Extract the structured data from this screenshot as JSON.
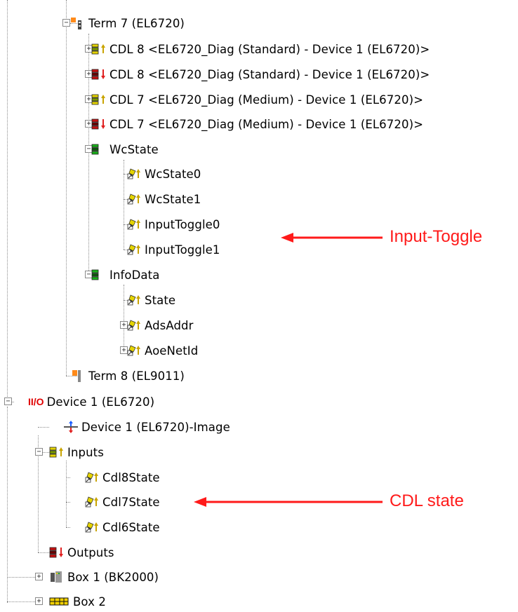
{
  "nodes": [
    {
      "label": "Term 7 (EL6720)",
      "icon": "terminal-icon",
      "expander": "minus"
    },
    {
      "label": "CDL 8 <EL6720_Diag (Standard) - Device 1 (EL6720)>",
      "icon": "input-var-group-icon",
      "expander": "plus"
    },
    {
      "label": "CDL 8 <EL6720_Diag (Standard) - Device 1 (EL6720)>",
      "icon": "output-var-group-icon",
      "expander": "plus"
    },
    {
      "label": "CDL 7 <EL6720_Diag (Medium) - Device 1 (EL6720)>",
      "icon": "input-var-group-icon",
      "expander": "plus"
    },
    {
      "label": "CDL 7 <EL6720_Diag (Medium) - Device 1 (EL6720)>",
      "icon": "output-var-group-icon",
      "expander": "plus"
    },
    {
      "label": "WcState",
      "icon": "green-var-group-icon",
      "expander": "minus"
    },
    {
      "label": "WcState0",
      "icon": "input-var-icon",
      "expander": ""
    },
    {
      "label": "WcState1",
      "icon": "input-var-icon",
      "expander": ""
    },
    {
      "label": "InputToggle0",
      "icon": "input-var-icon",
      "expander": ""
    },
    {
      "label": "InputToggle1",
      "icon": "input-var-icon",
      "expander": ""
    },
    {
      "label": "InfoData",
      "icon": "green-var-group-icon",
      "expander": "minus"
    },
    {
      "label": "State",
      "icon": "input-var-icon",
      "expander": ""
    },
    {
      "label": "AdsAddr",
      "icon": "input-var-icon",
      "expander": "plus"
    },
    {
      "label": "AoeNetId",
      "icon": "input-var-icon",
      "expander": "plus"
    },
    {
      "label": "Term 8 (EL9011)",
      "icon": "end-terminal-icon",
      "expander": ""
    },
    {
      "label": "Device 1 (EL6720)",
      "icon": "io-device-icon",
      "expander": "minus",
      "icon_text": "II/O"
    },
    {
      "label": "Device 1 (EL6720)-Image",
      "icon": "process-image-icon",
      "expander": ""
    },
    {
      "label": "Inputs",
      "icon": "input-var-group-icon",
      "expander": "minus"
    },
    {
      "label": "Cdl8State",
      "icon": "input-var-icon",
      "expander": ""
    },
    {
      "label": "Cdl7State",
      "icon": "input-var-icon",
      "expander": ""
    },
    {
      "label": "Cdl6State",
      "icon": "input-var-icon",
      "expander": ""
    },
    {
      "label": "Outputs",
      "icon": "output-var-group-icon",
      "expander": ""
    },
    {
      "label": "Box 1 (BK2000)",
      "icon": "box-bk2000-icon",
      "expander": "plus"
    },
    {
      "label": "Box 2",
      "icon": "box-icon",
      "expander": "plus"
    }
  ],
  "annotations": [
    {
      "text": "Input-Toggle",
      "color": "#ff1a1a"
    },
    {
      "text": "CDL state",
      "color": "#ff1a1a"
    }
  ],
  "colors": {
    "annotation": "#ff1a1a",
    "tree_line": "#8c8c8c"
  }
}
